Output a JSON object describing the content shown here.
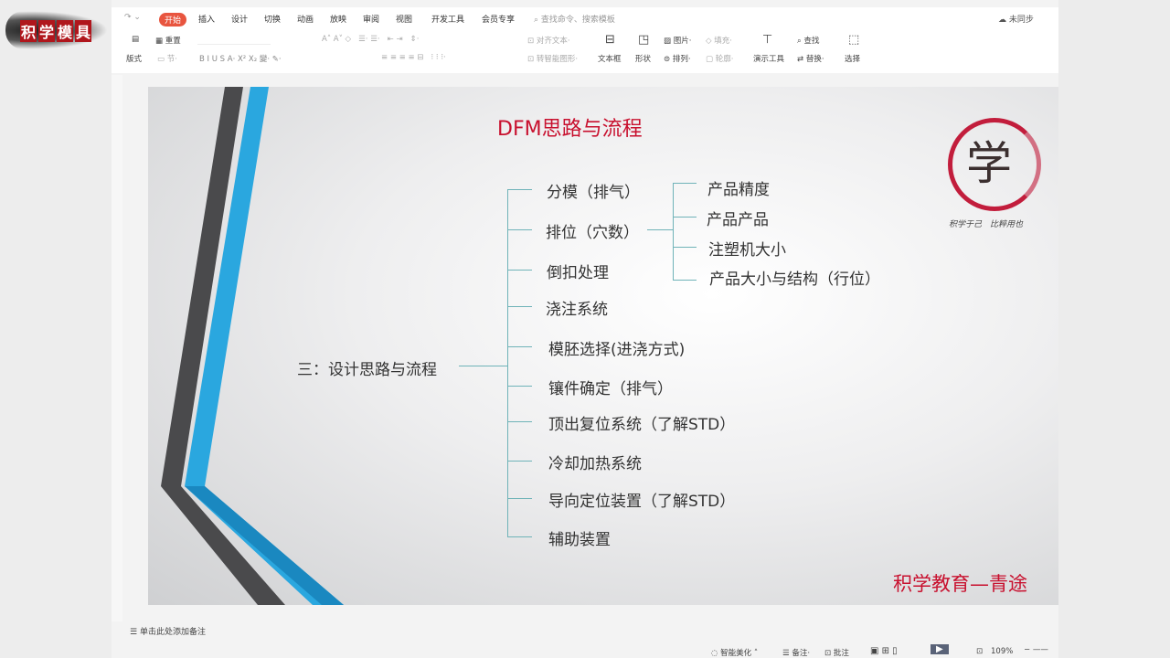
{
  "watermark_logo": {
    "text": "积学模具"
  },
  "ribbon": {
    "tabs": [
      "开始",
      "插入",
      "设计",
      "切换",
      "动画",
      "放映",
      "审阅",
      "视图",
      "开发工具",
      "会员专享"
    ],
    "search_placeholder": "查找命令、搜索模板",
    "sync": "未同步",
    "row1": [
      "重置",
      "对齐文本",
      "图片",
      "填充",
      "查找"
    ],
    "row2": [
      "版式",
      "节",
      "转智能图形",
      "文本框",
      "形状",
      "排列",
      "轮廓",
      "演示工具",
      "替换",
      "选择"
    ]
  },
  "slide": {
    "title": "DFM思路与流程",
    "logo_char": "学",
    "logo_caption": "积学于己 比粹用也",
    "root": "三：设计思路与流程",
    "items": [
      "分模（排气）",
      "排位（穴数）",
      "倒扣处理",
      "浇注系统",
      "模胚选择(进浇方式)",
      "镶件确定（排气）",
      "顶出复位系统（了解STD）",
      "冷却加热系统",
      "导向定位装置（了解STD）",
      "辅助装置"
    ],
    "subitems": [
      "产品精度",
      "产品产品",
      "注塑机大小",
      "产品大小与结构（行位）"
    ],
    "footer": "积学教育—青途"
  },
  "notes": {
    "placeholder": "单击此处添加备注"
  },
  "status": {
    "beautify": "智能美化",
    "notes": "备注",
    "comment": "批注",
    "zoom": "109%"
  },
  "colors": {
    "accent": "#e8553f",
    "title_red": "#c8102e",
    "line": "#6fb3b8"
  }
}
